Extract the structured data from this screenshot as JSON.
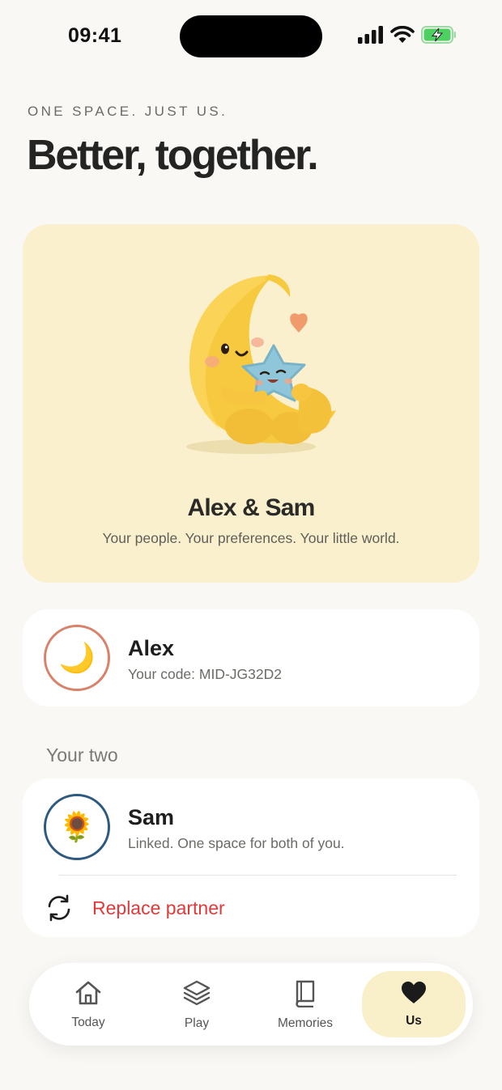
{
  "status_bar": {
    "time": "09:41"
  },
  "header": {
    "eyebrow": "ONE SPACE. JUST US.",
    "title": "Better, together."
  },
  "hero": {
    "title": "Alex & Sam",
    "subtitle": "Your people. Your preferences. Your little world."
  },
  "me": {
    "avatar_emoji": "🌙",
    "name": "Alex",
    "code_line": "Your code: MID-JG32D2"
  },
  "partner_section": {
    "label": "Your two",
    "avatar_emoji": "🌻",
    "name": "Sam",
    "status": "Linked. One space for both of you.",
    "replace_label": "Replace partner"
  },
  "tabs": [
    {
      "label": "Today",
      "icon": "home-icon"
    },
    {
      "label": "Play",
      "icon": "layers-icon"
    },
    {
      "label": "Memories",
      "icon": "book-icon"
    },
    {
      "label": "Us",
      "icon": "heart-icon",
      "active": true
    }
  ],
  "colors": {
    "background": "#faf8f4",
    "hero_bg": "#faf0cd",
    "me_ring": "#d9826a",
    "partner_ring": "#2f5a80",
    "danger": "#e0393a",
    "active_tab": "#f9efc9"
  }
}
